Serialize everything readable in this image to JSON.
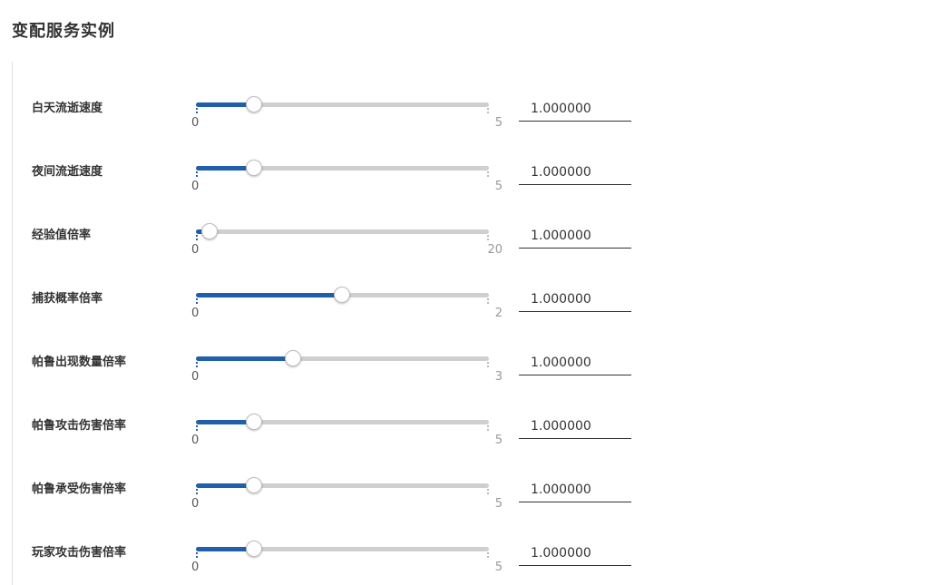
{
  "page": {
    "title": "变配服务实例"
  },
  "settings": [
    {
      "label": "白天流逝速度",
      "min": "0",
      "max": "5",
      "min_num": 0,
      "max_num": 5,
      "value_num": 1.0,
      "value": "1.000000"
    },
    {
      "label": "夜间流逝速度",
      "min": "0",
      "max": "5",
      "min_num": 0,
      "max_num": 5,
      "value_num": 1.0,
      "value": "1.000000"
    },
    {
      "label": "经验值倍率",
      "min": "0",
      "max": "20",
      "min_num": 0,
      "max_num": 20,
      "value_num": 1.0,
      "value": "1.000000"
    },
    {
      "label": "捕获概率倍率",
      "min": "0",
      "max": "2",
      "min_num": 0,
      "max_num": 2,
      "value_num": 1.0,
      "value": "1.000000"
    },
    {
      "label": "帕鲁出现数量倍率",
      "min": "0",
      "max": "3",
      "min_num": 0,
      "max_num": 3,
      "value_num": 1.0,
      "value": "1.000000"
    },
    {
      "label": "帕鲁攻击伤害倍率",
      "min": "0",
      "max": "5",
      "min_num": 0,
      "max_num": 5,
      "value_num": 1.0,
      "value": "1.000000"
    },
    {
      "label": "帕鲁承受伤害倍率",
      "min": "0",
      "max": "5",
      "min_num": 0,
      "max_num": 5,
      "value_num": 1.0,
      "value": "1.000000"
    },
    {
      "label": "玩家攻击伤害倍率",
      "min": "0",
      "max": "5",
      "min_num": 0,
      "max_num": 5,
      "value_num": 1.0,
      "value": "1.000000"
    }
  ],
  "colors": {
    "accent": "#1f5fab",
    "track": "#cfcfcf"
  }
}
